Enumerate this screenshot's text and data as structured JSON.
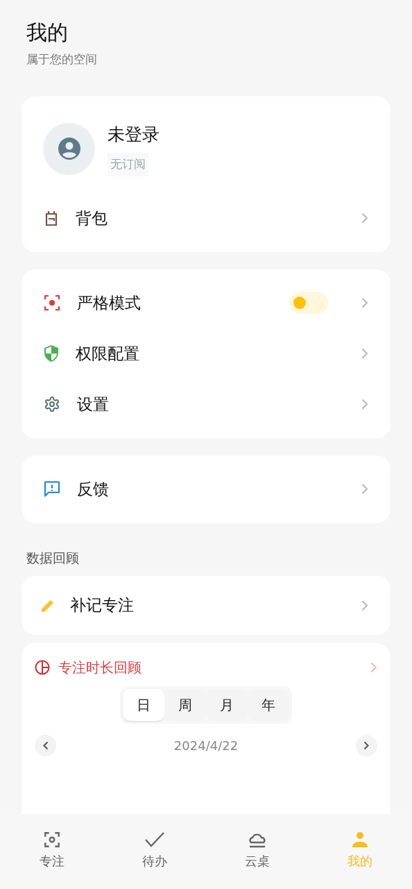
{
  "header": {
    "title": "我的",
    "subtitle": "属于您的空间"
  },
  "profile": {
    "name": "未登录",
    "subscription": "无订阅"
  },
  "profile_items": [
    {
      "label": "背包"
    }
  ],
  "settings_items": [
    {
      "label": "严格模式",
      "kind": "toggle",
      "on": false
    },
    {
      "label": "权限配置",
      "kind": "link"
    },
    {
      "label": "设置",
      "kind": "link"
    }
  ],
  "feedback_items": [
    {
      "label": "反馈"
    }
  ],
  "section_title": "数据回顾",
  "makeup_item": {
    "label": "补记专注"
  },
  "review": {
    "title": "专注时长回顾",
    "periods": [
      {
        "label": "日",
        "selected": true
      },
      {
        "label": "周",
        "selected": false
      },
      {
        "label": "月",
        "selected": false
      },
      {
        "label": "年",
        "selected": false
      }
    ],
    "date": "2024/4/22"
  },
  "bottom_nav": [
    {
      "label": "专注",
      "selected": false
    },
    {
      "label": "待办",
      "selected": false
    },
    {
      "label": "云桌",
      "selected": false
    },
    {
      "label": "我的",
      "selected": true
    }
  ]
}
